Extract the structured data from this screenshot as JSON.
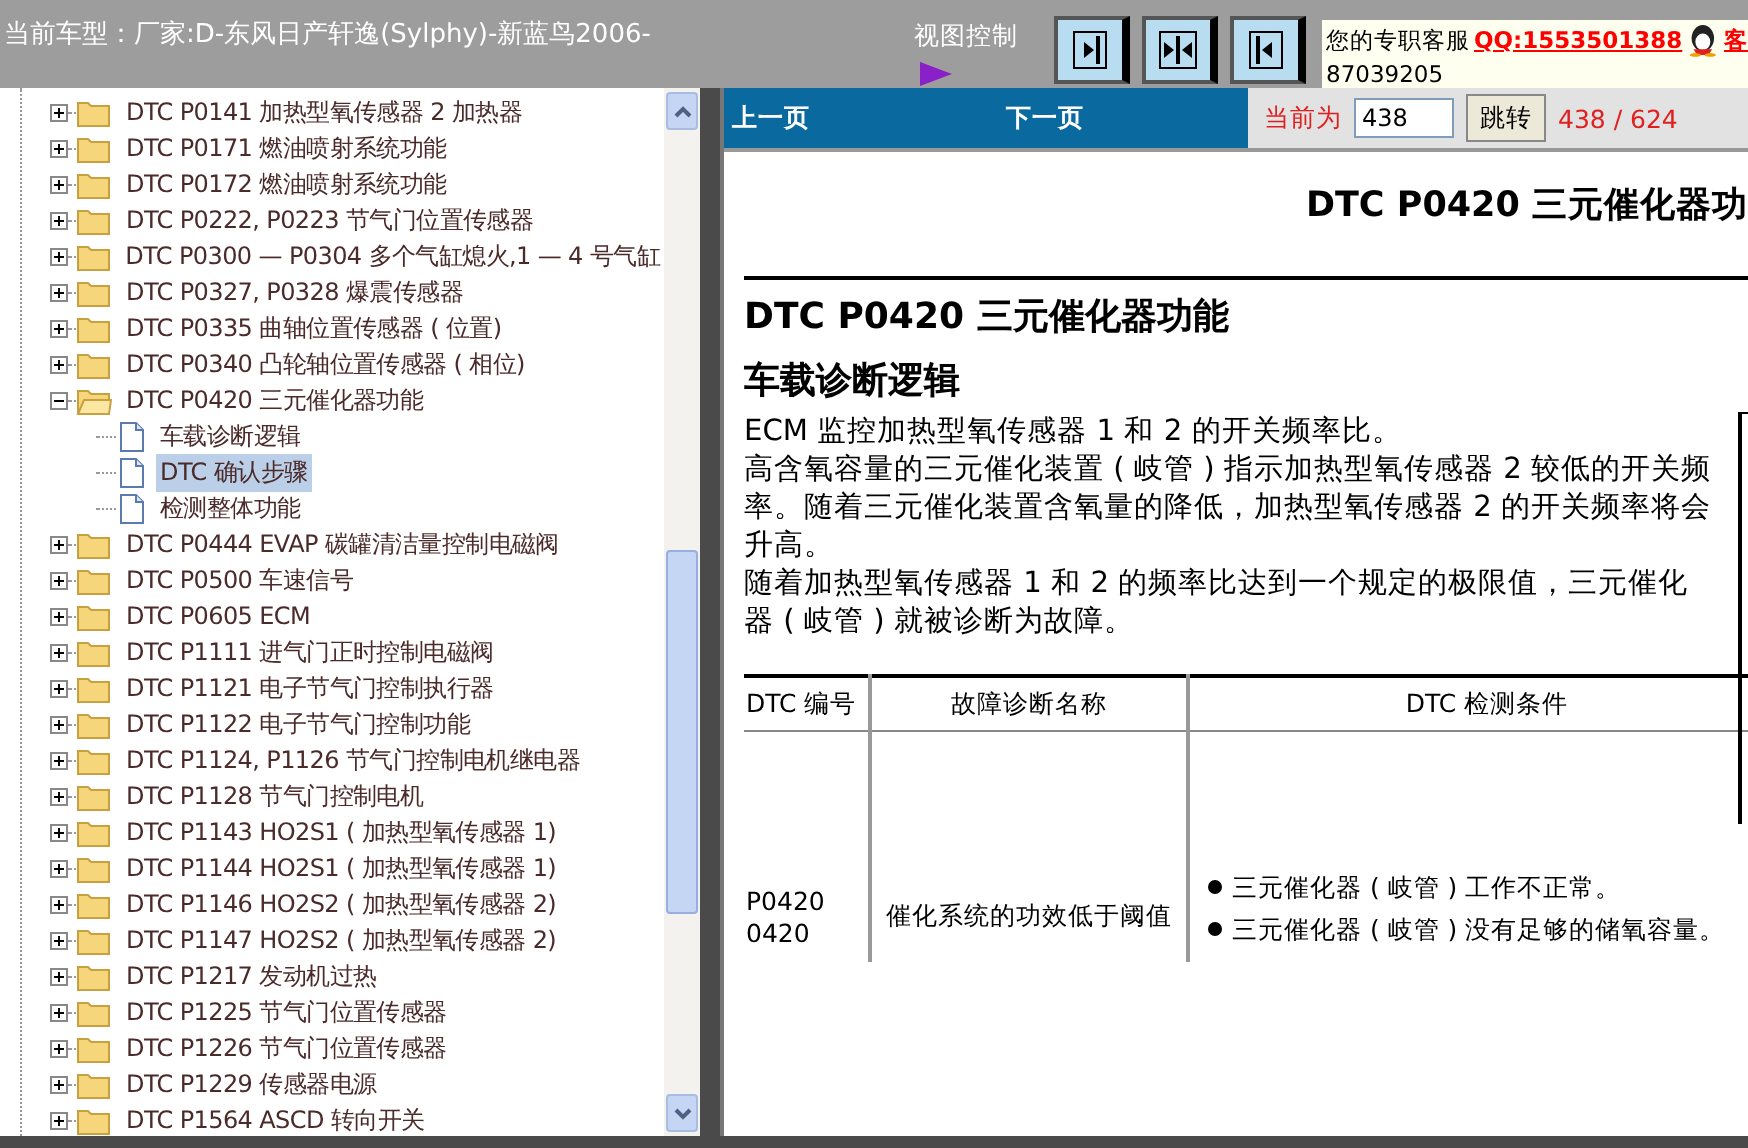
{
  "window": {
    "title": "当前车型：厂家:D-东风日产轩逸(Sylphy)-新蓝鸟2006-"
  },
  "view_control": {
    "label": "视图控制"
  },
  "service": {
    "label": "您的专职客服",
    "qq": "QQ:1553501388",
    "extra": "客",
    "phone": "87039205"
  },
  "tree": [
    {
      "label": "DTC P0141 加热型氧传感器 2 加热器",
      "expanded": false,
      "selected": false
    },
    {
      "label": "DTC P0171 燃油喷射系统功能",
      "expanded": false,
      "selected": false
    },
    {
      "label": "DTC P0172 燃油喷射系统功能",
      "expanded": false,
      "selected": false
    },
    {
      "label": "DTC P0222, P0223 节气门位置传感器",
      "expanded": false,
      "selected": false
    },
    {
      "label": "DTC P0300 — P0304 多个气缸熄火,1 — 4 号气缸",
      "expanded": false,
      "selected": false
    },
    {
      "label": "DTC P0327, P0328 爆震传感器",
      "expanded": false,
      "selected": false
    },
    {
      "label": "DTC P0335 曲轴位置传感器 ( 位置)",
      "expanded": false,
      "selected": false
    },
    {
      "label": "DTC P0340 凸轮轴位置传感器 ( 相位)",
      "expanded": false,
      "selected": false
    },
    {
      "label": "DTC P0420 三元催化器功能",
      "expanded": true,
      "selected": false,
      "children": [
        {
          "label": "车载诊断逻辑",
          "selected": false
        },
        {
          "label": "DTC 确认步骤",
          "selected": true
        },
        {
          "label": "检测整体功能",
          "selected": false
        }
      ]
    },
    {
      "label": "DTC P0444 EVAP 碳罐清洁量控制电磁阀",
      "expanded": false,
      "selected": false
    },
    {
      "label": "DTC P0500 车速信号",
      "expanded": false,
      "selected": false
    },
    {
      "label": "DTC P0605 ECM",
      "expanded": false,
      "selected": false
    },
    {
      "label": "DTC P1111 进气门正时控制电磁阀",
      "expanded": false,
      "selected": false
    },
    {
      "label": "DTC P1121 电子节气门控制执行器",
      "expanded": false,
      "selected": false
    },
    {
      "label": "DTC P1122 电子节气门控制功能",
      "expanded": false,
      "selected": false
    },
    {
      "label": "DTC P1124, P1126 节气门控制电机继电器",
      "expanded": false,
      "selected": false
    },
    {
      "label": "DTC P1128 节气门控制电机",
      "expanded": false,
      "selected": false
    },
    {
      "label": "DTC P1143 HO2S1 ( 加热型氧传感器 1)",
      "expanded": false,
      "selected": false
    },
    {
      "label": "DTC P1144 HO2S1 ( 加热型氧传感器 1)",
      "expanded": false,
      "selected": false
    },
    {
      "label": "DTC P1146 HO2S2 ( 加热型氧传感器 2)",
      "expanded": false,
      "selected": false
    },
    {
      "label": "DTC P1147 HO2S2 ( 加热型氧传感器 2)",
      "expanded": false,
      "selected": false
    },
    {
      "label": "DTC P1217 发动机过热",
      "expanded": false,
      "selected": false
    },
    {
      "label": "DTC P1225 节气门位置传感器",
      "expanded": false,
      "selected": false
    },
    {
      "label": "DTC P1226 节气门位置传感器",
      "expanded": false,
      "selected": false
    },
    {
      "label": "DTC P1229 传感器电源",
      "expanded": false,
      "selected": false
    },
    {
      "label": "DTC P1564 ASCD 转向开关",
      "expanded": false,
      "selected": false
    }
  ],
  "pager": {
    "prev": "上一页",
    "next": "下一页",
    "current_label": "当前为",
    "current_value": "438",
    "jump": "跳转",
    "count": "438 / 624"
  },
  "document": {
    "header": "DTC P0420 三元催化器功",
    "title": "DTC P0420 三元催化器功能",
    "subtitle": "车载诊断逻辑",
    "paragraphs": [
      "ECM 监控加热型氧传感器 1 和 2 的开关频率比。",
      "高含氧容量的三元催化装置 ( 岐管 ) 指示加热型氧传感器 2 较低的开关频率。随着三元催化装置含氧量的降低，加热型氧传感器 2 的开关频率将会升高。",
      "随着加热型氧传感器 1 和 2 的频率比达到一个规定的极限值，三元催化器 ( 岐管 ) 就被诊断为故障。"
    ],
    "table": {
      "columns": [
        "DTC 编号",
        "故障诊断名称",
        "DTC 检测条件"
      ],
      "rows": [
        {
          "code": [
            "P0420",
            "0420"
          ],
          "name": "催化系统的功效低于阈值",
          "conditions": [
            "三元催化器 ( 岐管 ) 工作不正常。",
            "三元催化器 ( 岐管 ) 没有足够的储氧容量。"
          ]
        }
      ]
    }
  }
}
